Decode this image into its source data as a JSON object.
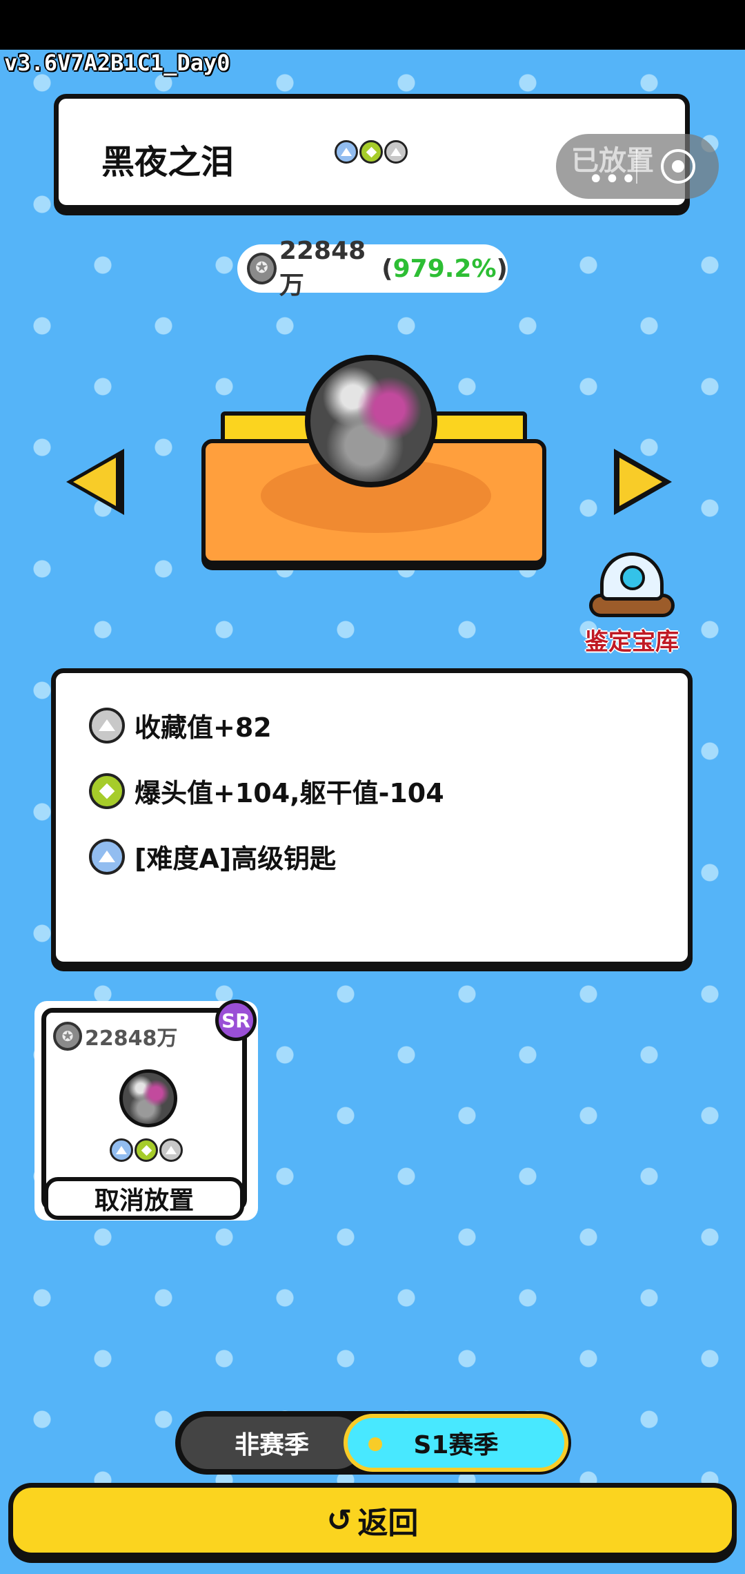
{
  "version": "v3.6V7A2B1C1_Day0",
  "item": {
    "name": "黑夜之泪",
    "status": "已放置",
    "price": "22848万",
    "percent": "979.2%"
  },
  "vault_label": "鉴定宝库",
  "attributes": [
    {
      "text": "收藏值+82",
      "rune": "gray"
    },
    {
      "text": "爆头值+104,躯干值-104",
      "rune": "green"
    },
    {
      "text": "[难度A]高级钥匙",
      "rune": "blue"
    }
  ],
  "card": {
    "price": "22848万",
    "rarity": "SR",
    "button": "取消放置"
  },
  "season": {
    "off_label": "非赛季",
    "on_label": "S1赛季"
  },
  "back_label": "返回",
  "icons": {
    "rune_colors": {
      "blue": "#92bdf0",
      "green": "#a6cc2a",
      "gray": "#c8c8c8"
    },
    "accent_yellow": "#fbd41f",
    "percent_green": "#2dbe34"
  }
}
